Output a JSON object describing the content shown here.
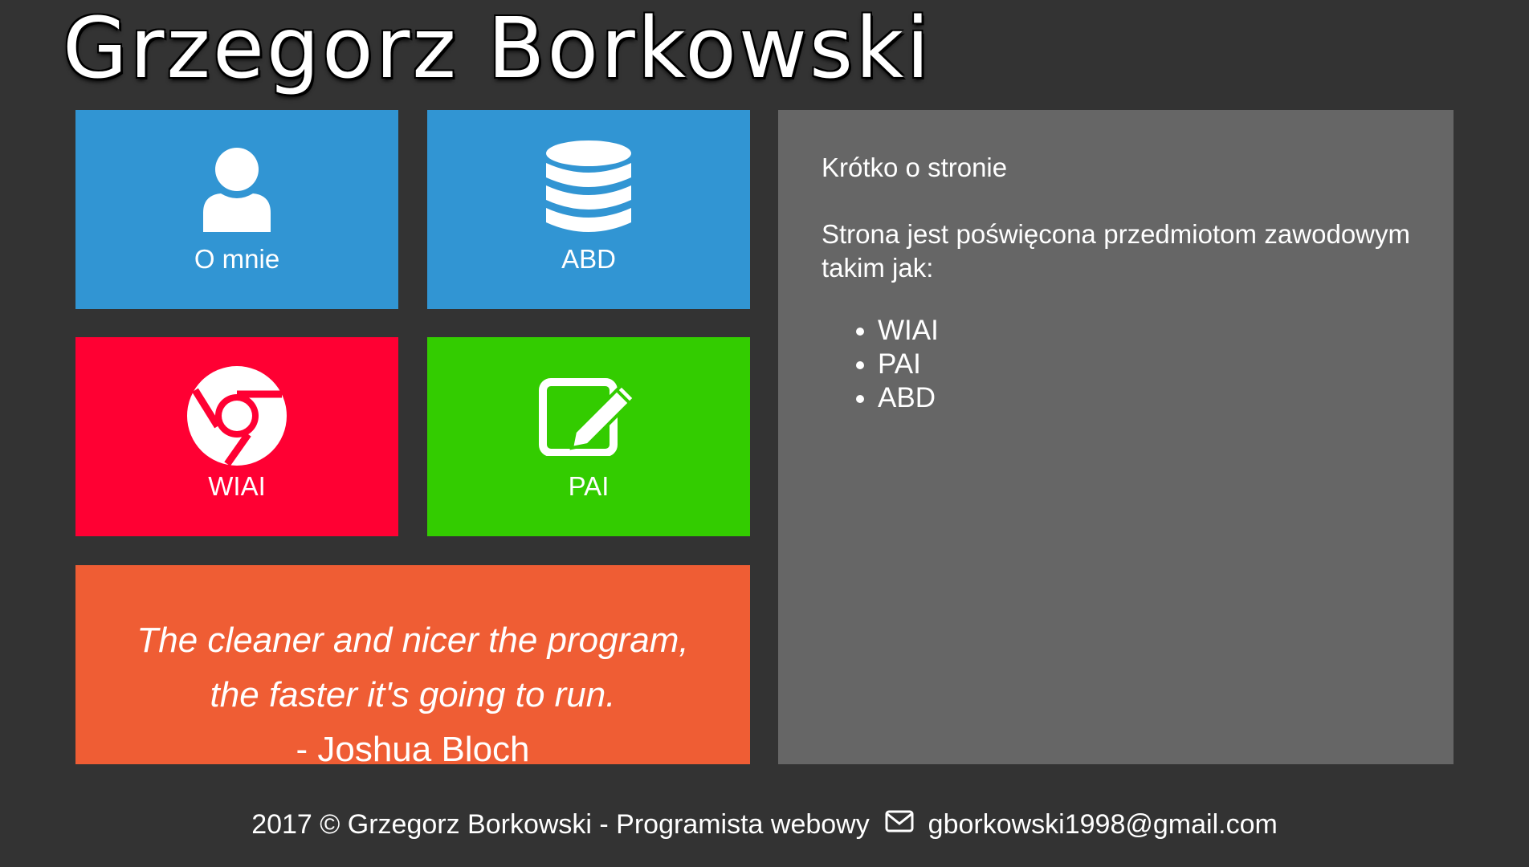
{
  "header": {
    "logo_text": "Grzegorz Borkowski"
  },
  "tiles": [
    {
      "label": "O mnie",
      "icon": "user-icon",
      "color": "#3195d3"
    },
    {
      "label": "ABD",
      "icon": "database-icon",
      "color": "#3195d3"
    },
    {
      "label": "WIAI",
      "icon": "chrome-icon",
      "color": "#ff0033"
    },
    {
      "label": "PAI",
      "icon": "edit-icon",
      "color": "#33cc00"
    }
  ],
  "quote": {
    "line1": "The cleaner and nicer the program,",
    "line2": "the faster it's going to run.",
    "author": "- Joshua Bloch",
    "color": "#ef5d34"
  },
  "info": {
    "title": "Krótko o stronie",
    "paragraph": "Strona jest poświęcona przedmiotom zawodowym takim jak:",
    "items": [
      "WIAI",
      "PAI",
      "ABD"
    ],
    "color": "#666666"
  },
  "footer": {
    "copyright": "2017 © Grzegorz Borkowski - Programista webowy",
    "email": "gborkowski1998@gmail.com",
    "email_icon": "envelope-icon"
  },
  "theme": {
    "background": "#333333",
    "text": "#ffffff"
  }
}
